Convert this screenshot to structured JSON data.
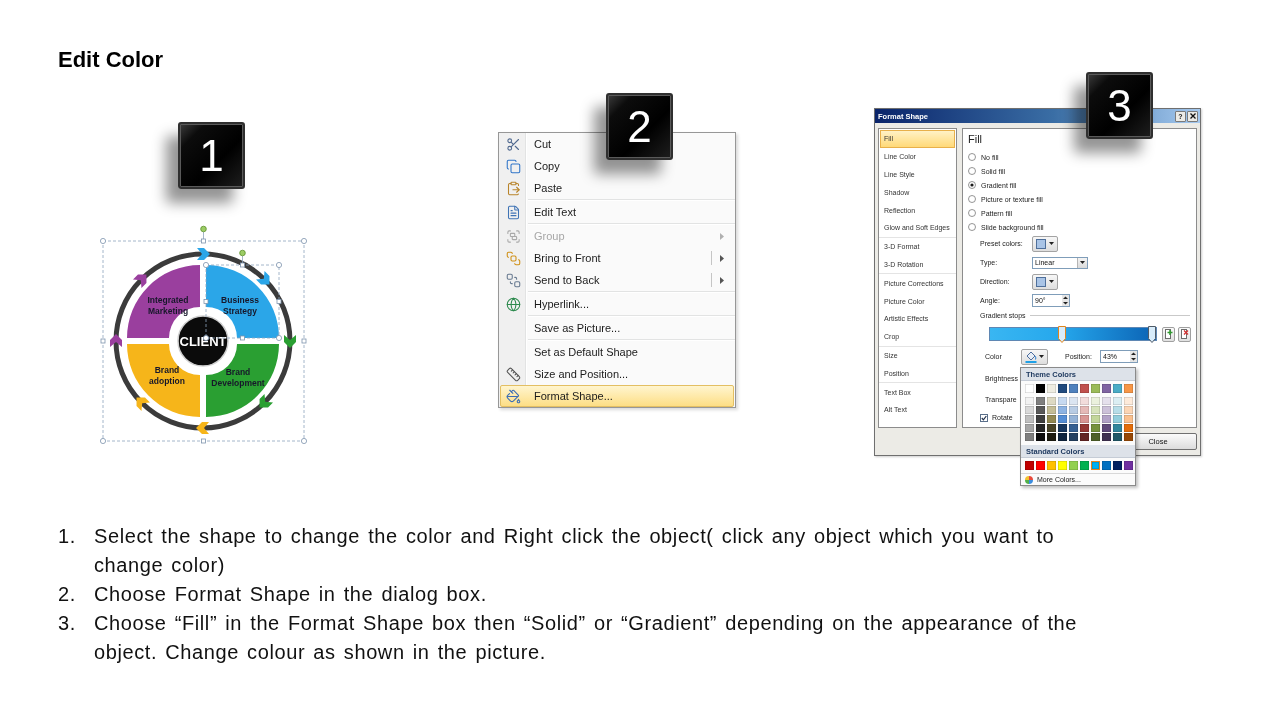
{
  "title": "Edit Color",
  "diagram": {
    "step": "1",
    "center": "CLIENT",
    "quadrants": [
      {
        "label": "Integrated Marketing",
        "color": "#9a3f9e"
      },
      {
        "label": "Business Strategy",
        "color": "#2ba6e8"
      },
      {
        "label": "Brand adoption",
        "color": "#f6b51a"
      },
      {
        "label": "Brand Development",
        "color": "#2a9f32"
      }
    ]
  },
  "context_menu": {
    "step": "2",
    "groups": [
      [
        {
          "label": "Cut",
          "kind": "command",
          "disabled": false,
          "selected": false
        },
        {
          "label": "Copy",
          "kind": "command",
          "disabled": false,
          "selected": false
        },
        {
          "label": "Paste",
          "kind": "command",
          "disabled": false,
          "selected": false
        }
      ],
      [
        {
          "label": "Edit Text",
          "kind": "command",
          "disabled": false,
          "selected": false
        }
      ],
      [
        {
          "label": "Group",
          "kind": "submenu",
          "disabled": true,
          "selected": false
        },
        {
          "label": "Bring to Front",
          "kind": "split",
          "disabled": false,
          "selected": false
        },
        {
          "label": "Send to Back",
          "kind": "split",
          "disabled": false,
          "selected": false
        }
      ],
      [
        {
          "label": "Hyperlink...",
          "kind": "command",
          "disabled": false,
          "selected": false
        }
      ],
      [
        {
          "label": "Save as Picture...",
          "kind": "command",
          "disabled": false,
          "selected": false
        }
      ],
      [
        {
          "label": "Set as Default Shape",
          "kind": "command",
          "disabled": false,
          "selected": false
        },
        {
          "label": "Size and Position...",
          "kind": "command",
          "disabled": false,
          "selected": false
        },
        {
          "label": "Format Shape...",
          "kind": "command",
          "disabled": false,
          "selected": true
        }
      ]
    ]
  },
  "format_shape_dialog": {
    "step": "3",
    "title": "Format Shape",
    "help_button": "?",
    "categories": [
      [
        {
          "label": "Fill",
          "selected": true
        },
        {
          "label": "Line Color",
          "selected": false
        },
        {
          "label": "Line Style",
          "selected": false
        },
        {
          "label": "Shadow",
          "selected": false
        },
        {
          "label": "Reflection",
          "selected": false
        },
        {
          "label": "Glow and Soft Edges",
          "selected": false
        }
      ],
      [
        {
          "label": "3-D Format",
          "selected": false
        },
        {
          "label": "3-D Rotation",
          "selected": false
        }
      ],
      [
        {
          "label": "Picture Corrections",
          "selected": false
        },
        {
          "label": "Picture Color",
          "selected": false
        },
        {
          "label": "Artistic Effects",
          "selected": false
        },
        {
          "label": "Crop",
          "selected": false
        }
      ],
      [
        {
          "label": "Size",
          "selected": false
        },
        {
          "label": "Position",
          "selected": false
        }
      ],
      [
        {
          "label": "Text Box",
          "selected": false
        },
        {
          "label": "Alt Text",
          "selected": false
        }
      ]
    ],
    "pane": {
      "heading": "Fill",
      "fill_options": [
        {
          "label": "No fill",
          "selected": false
        },
        {
          "label": "Solid fill",
          "selected": false
        },
        {
          "label": "Gradient fill",
          "selected": true
        },
        {
          "label": "Picture or texture fill",
          "selected": false
        },
        {
          "label": "Pattern fill",
          "selected": false
        },
        {
          "label": "Slide background fill",
          "selected": false
        }
      ],
      "preset_colors": {
        "label": "Preset colors:"
      },
      "type": {
        "label": "Type:",
        "value": "Linear"
      },
      "direction": {
        "label": "Direction:"
      },
      "angle": {
        "label": "Angle:",
        "value": "90°"
      },
      "gradient_stops": {
        "label": "Gradient stops",
        "stops": [
          {
            "level": 0.43,
            "selected": true
          },
          {
            "level": 1,
            "selected": false
          }
        ]
      },
      "color": {
        "label": "Color"
      },
      "position": {
        "label": "Position:",
        "value": "43%"
      },
      "brightness": {
        "label": "Brightness"
      },
      "transparency": {
        "label": "Transpare"
      },
      "rotate": {
        "label": "Rotate",
        "checked": true
      }
    },
    "close_button": "Close",
    "color_menu": {
      "theme_heading": "Theme Colors",
      "theme_rows": [
        [
          {
            "color": "#ffffff",
            "selected": false
          },
          {
            "color": "#000000",
            "selected": false
          },
          {
            "color": "#eeece1",
            "selected": false
          },
          {
            "color": "#1f497d",
            "selected": false
          },
          {
            "color": "#4f81bd",
            "selected": false
          },
          {
            "color": "#c0504d",
            "selected": false
          },
          {
            "color": "#9bbb59",
            "selected": false
          },
          {
            "color": "#8064a2",
            "selected": false
          },
          {
            "color": "#4bacc6",
            "selected": false
          },
          {
            "color": "#f79646",
            "selected": false
          }
        ],
        [
          {
            "color": "#f2f2f2",
            "selected": false
          },
          {
            "color": "#7f7f7f",
            "selected": false
          },
          {
            "color": "#ddd9c3",
            "selected": false
          },
          {
            "color": "#c6d9f0",
            "selected": false
          },
          {
            "color": "#dbe5f1",
            "selected": false
          },
          {
            "color": "#f2dcdb",
            "selected": false
          },
          {
            "color": "#ebf1dd",
            "selected": false
          },
          {
            "color": "#e5e0ec",
            "selected": false
          },
          {
            "color": "#dbeef3",
            "selected": false
          },
          {
            "color": "#fdeada",
            "selected": false
          }
        ],
        [
          {
            "color": "#d9d9d9",
            "selected": false
          },
          {
            "color": "#595959",
            "selected": false
          },
          {
            "color": "#c4bd97",
            "selected": false
          },
          {
            "color": "#8db3e2",
            "selected": false
          },
          {
            "color": "#b8cce4",
            "selected": false
          },
          {
            "color": "#e5b9b7",
            "selected": false
          },
          {
            "color": "#d7e3bc",
            "selected": false
          },
          {
            "color": "#ccc1d9",
            "selected": false
          },
          {
            "color": "#b7dde8",
            "selected": false
          },
          {
            "color": "#fbd5b5",
            "selected": false
          }
        ],
        [
          {
            "color": "#bfbfbf",
            "selected": false
          },
          {
            "color": "#3f3f3f",
            "selected": false
          },
          {
            "color": "#938953",
            "selected": false
          },
          {
            "color": "#548dd4",
            "selected": false
          },
          {
            "color": "#95b3d7",
            "selected": false
          },
          {
            "color": "#d99694",
            "selected": false
          },
          {
            "color": "#c3d69b",
            "selected": false
          },
          {
            "color": "#b2a2c7",
            "selected": false
          },
          {
            "color": "#92cddc",
            "selected": false
          },
          {
            "color": "#fac08f",
            "selected": false
          }
        ],
        [
          {
            "color": "#a6a6a6",
            "selected": false
          },
          {
            "color": "#262626",
            "selected": false
          },
          {
            "color": "#494429",
            "selected": false
          },
          {
            "color": "#17365d",
            "selected": false
          },
          {
            "color": "#366092",
            "selected": false
          },
          {
            "color": "#953734",
            "selected": false
          },
          {
            "color": "#76923c",
            "selected": false
          },
          {
            "color": "#5f497a",
            "selected": false
          },
          {
            "color": "#31859b",
            "selected": false
          },
          {
            "color": "#e36c09",
            "selected": false
          }
        ],
        [
          {
            "color": "#808080",
            "selected": false
          },
          {
            "color": "#0d0d0d",
            "selected": false
          },
          {
            "color": "#1d1b10",
            "selected": false
          },
          {
            "color": "#0f243e",
            "selected": false
          },
          {
            "color": "#244061",
            "selected": false
          },
          {
            "color": "#632423",
            "selected": false
          },
          {
            "color": "#4f6128",
            "selected": false
          },
          {
            "color": "#3f3151",
            "selected": false
          },
          {
            "color": "#205867",
            "selected": false
          },
          {
            "color": "#974806",
            "selected": false
          }
        ]
      ],
      "standard_heading": "Standard Colors",
      "standard_colors": [
        {
          "color": "#c00000",
          "selected": false
        },
        {
          "color": "#ff0000",
          "selected": false
        },
        {
          "color": "#ffc000",
          "selected": false
        },
        {
          "color": "#ffff00",
          "selected": false
        },
        {
          "color": "#92d050",
          "selected": false
        },
        {
          "color": "#00b050",
          "selected": false
        },
        {
          "color": "#00b0f0",
          "selected": true
        },
        {
          "color": "#0070c0",
          "selected": false
        },
        {
          "color": "#002060",
          "selected": false
        },
        {
          "color": "#7030a0",
          "selected": false
        }
      ],
      "more_colors": "More Colors..."
    }
  },
  "steps": [
    {
      "number": "1.",
      "text": "Select the shape to change the color and Right click the object( click any object which you want to change color)"
    },
    {
      "number": "2.",
      "text": "Choose Format Shape in the dialog box."
    },
    {
      "number": "3.",
      "text": "Choose “Fill” in the Format Shape box then “Solid” or “Gradient” depending on the appearance of the object. Change colour as shown in the picture."
    }
  ]
}
